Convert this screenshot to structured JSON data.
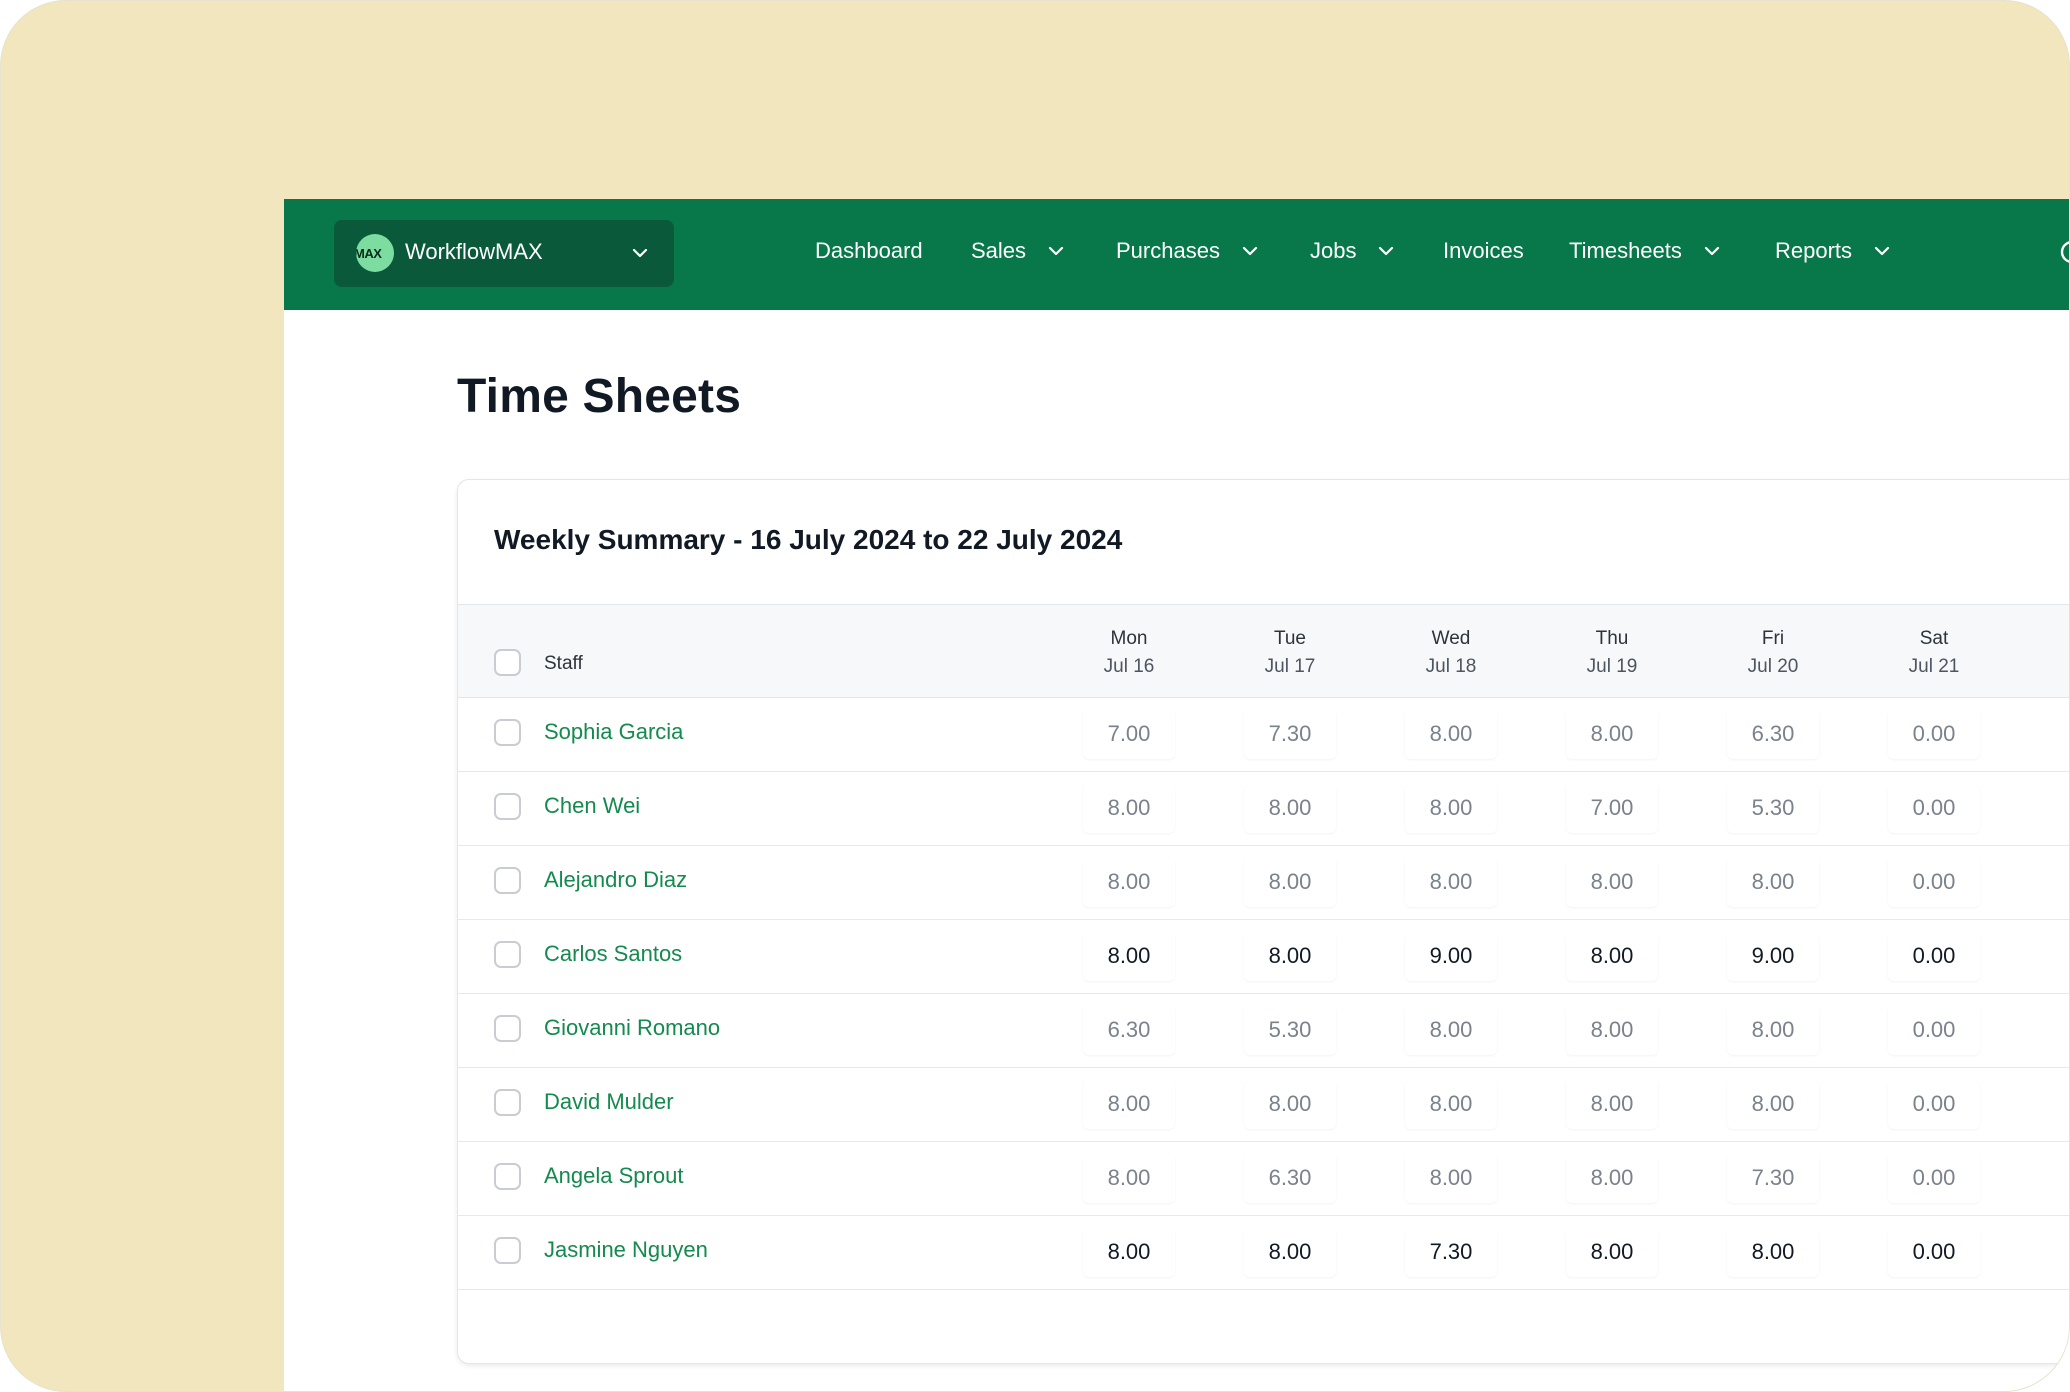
{
  "app": {
    "org_logo_text": "MAX",
    "org_name": "WorkflowMAX"
  },
  "nav": {
    "items": [
      {
        "label": "Dashboard",
        "has_dropdown": false
      },
      {
        "label": "Sales",
        "has_dropdown": true
      },
      {
        "label": "Purchases",
        "has_dropdown": true
      },
      {
        "label": "Jobs",
        "has_dropdown": true
      },
      {
        "label": "Invoices",
        "has_dropdown": false
      },
      {
        "label": "Timesheets",
        "has_dropdown": true
      },
      {
        "label": "Reports",
        "has_dropdown": true
      }
    ]
  },
  "page": {
    "title": "Time Sheets"
  },
  "summary": {
    "title": "Weekly Summary - 16 July 2024 to 22 July 2024",
    "staff_header": "Staff",
    "days": [
      {
        "day": "Mon",
        "date": "Jul 16"
      },
      {
        "day": "Tue",
        "date": "Jul 17"
      },
      {
        "day": "Wed",
        "date": "Jul 18"
      },
      {
        "day": "Thu",
        "date": "Jul 19"
      },
      {
        "day": "Fri",
        "date": "Jul 20"
      },
      {
        "day": "Sat",
        "date": "Jul 21"
      }
    ],
    "rows": [
      {
        "name": "Sophia Garcia",
        "hours": [
          "7.00",
          "7.30",
          "8.00",
          "8.00",
          "6.30",
          "0.00"
        ],
        "emphasized": false
      },
      {
        "name": "Chen Wei",
        "hours": [
          "8.00",
          "8.00",
          "8.00",
          "7.00",
          "5.30",
          "0.00"
        ],
        "emphasized": false
      },
      {
        "name": "Alejandro Diaz",
        "hours": [
          "8.00",
          "8.00",
          "8.00",
          "8.00",
          "8.00",
          "0.00"
        ],
        "emphasized": false
      },
      {
        "name": "Carlos Santos",
        "hours": [
          "8.00",
          "8.00",
          "9.00",
          "8.00",
          "9.00",
          "0.00"
        ],
        "emphasized": true
      },
      {
        "name": "Giovanni Romano",
        "hours": [
          "6.30",
          "5.30",
          "8.00",
          "8.00",
          "8.00",
          "0.00"
        ],
        "emphasized": false
      },
      {
        "name": "David Mulder",
        "hours": [
          "8.00",
          "8.00",
          "8.00",
          "8.00",
          "8.00",
          "0.00"
        ],
        "emphasized": false
      },
      {
        "name": "Angela Sprout",
        "hours": [
          "8.00",
          "6.30",
          "8.00",
          "8.00",
          "7.30",
          "0.00"
        ],
        "emphasized": false
      },
      {
        "name": "Jasmine Nguyen",
        "hours": [
          "8.00",
          "8.00",
          "7.30",
          "8.00",
          "8.00",
          "0.00"
        ],
        "emphasized": true
      }
    ]
  },
  "colors": {
    "nav_background": "#08774a",
    "org_switch_background": "#09593a",
    "staff_link": "#148a4e",
    "outer_background": "#f1e6bd"
  }
}
